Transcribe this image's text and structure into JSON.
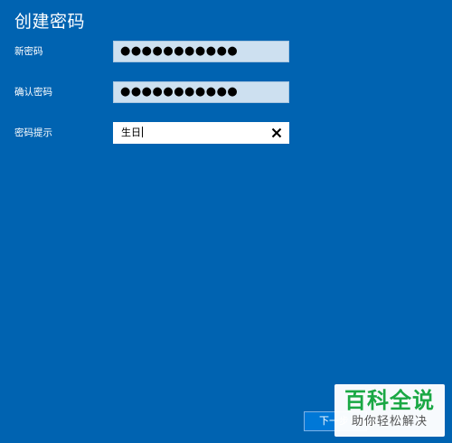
{
  "title": "创建密码",
  "fields": [
    {
      "label": "新密码",
      "value": "●●●●●●●●●●●"
    },
    {
      "label": "确认密码",
      "value": "●●●●●●●●●●●"
    },
    {
      "label": "密码提示",
      "value": "生日"
    }
  ],
  "buttons": {
    "next_label": "下一步"
  },
  "watermark": {
    "main": "百科全说",
    "sub": "助你轻松解决"
  },
  "icons": {
    "clear": "close-icon"
  },
  "colors": {
    "background": "#0063b1",
    "password_field": "#cde0f0",
    "watermark_green": "#1aa844"
  }
}
